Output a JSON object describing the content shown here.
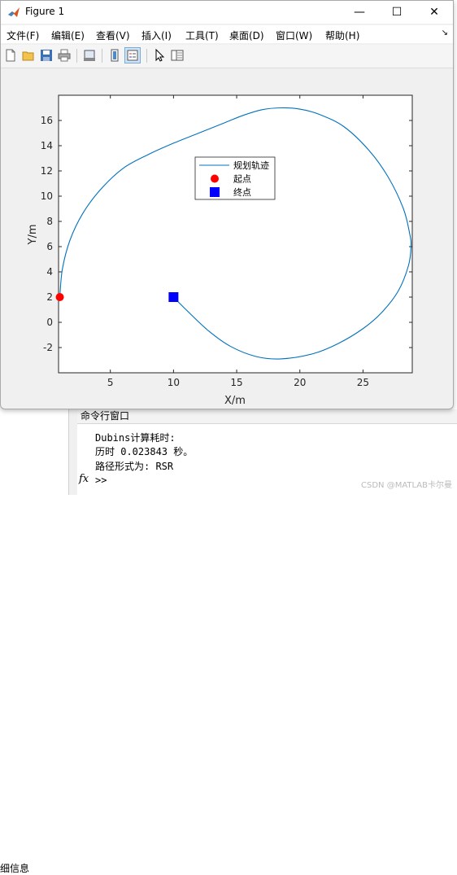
{
  "window": {
    "title": "Figure 1",
    "controls": {
      "minimize": "—",
      "maximize": "☐",
      "close": "✕"
    }
  },
  "menubar": {
    "items": [
      "文件(F)",
      "编辑(E)",
      "查看(V)",
      "插入(I)",
      "工具(T)",
      "桌面(D)",
      "窗口(W)",
      "帮助(H)"
    ],
    "overflow": "↘"
  },
  "toolbar": {
    "icons": [
      "new-figure-icon",
      "open-file-icon",
      "save-icon",
      "print-icon",
      "print-preview-icon",
      "colorbar-icon",
      "legend-icon",
      "pointer-icon",
      "property-editor-icon"
    ],
    "pressed": "legend-icon"
  },
  "chart_data": {
    "type": "line",
    "xlabel": "X/m",
    "ylabel": "Y/m",
    "xlim": [
      0.9,
      28.9
    ],
    "ylim": [
      -4.0,
      18.0
    ],
    "xticks": [
      5,
      10,
      15,
      20,
      25
    ],
    "yticks": [
      -2,
      0,
      2,
      4,
      6,
      8,
      10,
      12,
      14,
      16
    ],
    "grid": false,
    "legend_position": "top-center",
    "series": [
      {
        "name": "规划轨迹",
        "style": "line",
        "color": "#0072BD",
        "x": [
          1.0,
          1.2,
          1.8,
          2.8,
          4.2,
          6.0,
          8.0,
          10.0,
          12.0,
          14.0,
          15.5,
          17.0,
          18.5,
          20.0,
          21.5,
          23.5,
          25.5,
          27.0,
          28.2,
          28.7,
          28.8,
          28.6,
          27.8,
          26.5,
          25.0,
          23.0,
          21.0,
          18.5,
          16.5,
          14.5,
          12.8,
          11.2,
          10.0
        ],
        "y": [
          2.0,
          4.2,
          6.5,
          8.6,
          10.5,
          12.2,
          13.3,
          14.2,
          15.0,
          15.8,
          16.4,
          16.85,
          17.0,
          16.9,
          16.5,
          15.5,
          13.6,
          11.5,
          9.0,
          7.0,
          6.0,
          4.5,
          2.5,
          0.8,
          -0.5,
          -1.7,
          -2.5,
          -2.9,
          -2.7,
          -1.9,
          -0.7,
          0.8,
          2.0
        ]
      },
      {
        "name": "起点",
        "style": "marker",
        "marker": "circle",
        "color": "#ff0000",
        "x": [
          1.0
        ],
        "y": [
          2.0
        ]
      },
      {
        "name": "终点",
        "style": "marker",
        "marker": "square",
        "color": "#0000ff",
        "x": [
          10.0
        ],
        "y": [
          2.0
        ]
      }
    ]
  },
  "desktop": {
    "left_panel_text": "细信息",
    "command_window": {
      "title": "命令行窗口",
      "lines": [
        "Dubins计算耗时:",
        "历时 0.023843 秒。",
        "路径形式为: RSR"
      ],
      "fx_label": "fx",
      "prompt": ">>"
    },
    "watermark": "CSDN @MATLAB卡尔曼"
  }
}
